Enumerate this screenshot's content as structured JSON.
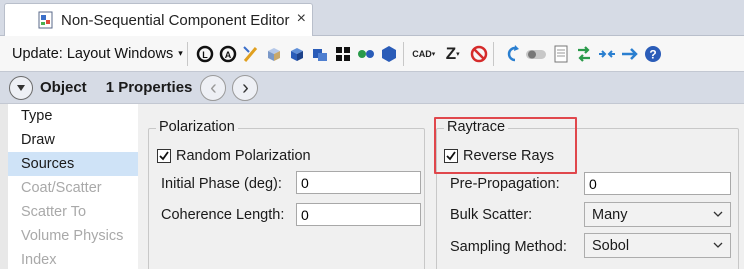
{
  "tab": {
    "title": "Non-Sequential Component Editor",
    "close": "×"
  },
  "toolbar": {
    "update_label": "Update: Layout Windows",
    "update_caret": "▾",
    "cad_label": "CAD",
    "z_label": "Z"
  },
  "object_bar": {
    "object_label": "Object",
    "properties_label": "1 Properties",
    "prev_glyph": "‹",
    "next_glyph": "›"
  },
  "left_nav": {
    "items": [
      {
        "label": "Type",
        "state": "normal"
      },
      {
        "label": "Draw",
        "state": "normal"
      },
      {
        "label": "Sources",
        "state": "selected"
      },
      {
        "label": "Coat/Scatter",
        "state": "disabled"
      },
      {
        "label": "Scatter To",
        "state": "disabled"
      },
      {
        "label": "Volume Physics",
        "state": "disabled"
      },
      {
        "label": "Index",
        "state": "disabled"
      }
    ]
  },
  "polarization": {
    "legend": "Polarization",
    "random_label": "Random Polarization",
    "random_checked": true,
    "phase_label": "Initial Phase (deg):",
    "phase_value": "0",
    "coherence_label": "Coherence Length:",
    "coherence_value": "0"
  },
  "raytrace": {
    "legend": "Raytrace",
    "reverse_label": "Reverse Rays",
    "reverse_checked": true,
    "prepropagation_label": "Pre-Propagation:",
    "prepropagation_value": "0",
    "bulk_label": "Bulk Scatter:",
    "bulk_value": "Many",
    "sampling_label": "Sampling Method:",
    "sampling_value": "Sobol"
  },
  "colors": {
    "highlight": "#e0474c",
    "selected_bg": "#cfe3f7",
    "header_bg": "#d6dbe5"
  }
}
